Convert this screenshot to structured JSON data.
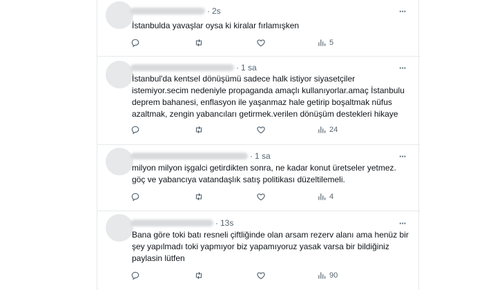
{
  "tweets": [
    {
      "time": "2s",
      "text": "İstanbulda yavaşlar oysa ki kiralar fırlamışken",
      "views": "5"
    },
    {
      "time": "1 sa",
      "text": "İstanbul'da kentsel dönüşümü sadece halk istiyor siyasetçiler\nistemiyor.secim nedeniyle propaganda amaçlı kullanıyorlar.amaç İstanbulu\ndeprem bahanesi, enflasyon ile yaşanmaz hale getirip boşaltmak nüfus\nazaltmak, zengin yabancıları getirmek.verilen dönüşüm destekleri  hikaye",
      "views": "24"
    },
    {
      "time": "1 sa",
      "text": "milyon milyon işgalci getirdikten sonra, ne kadar konut üretseler yetmez.\ngöç ve yabancıya vatandaşlık satış politikası düzeltilemeli.",
      "views": "4"
    },
    {
      "time": "13s",
      "text": "Bana göre toki batı resneli çiftliğinde olan arsam rezerv alanı ama henüz bir\nşey yapılmadı toki yapmıyor biz yapamıyoruz yasak varsa bir bildiğiniz\npaylasin lütfen",
      "views": "90"
    }
  ],
  "icons": {
    "reply": "reply-icon",
    "retweet": "retweet-icon",
    "like": "heart-icon",
    "views": "analytics-icon",
    "more": "more-icon"
  },
  "colors": {
    "icon_gray": "#536471",
    "text": "#0f1419",
    "divider": "#e6e8ea"
  }
}
